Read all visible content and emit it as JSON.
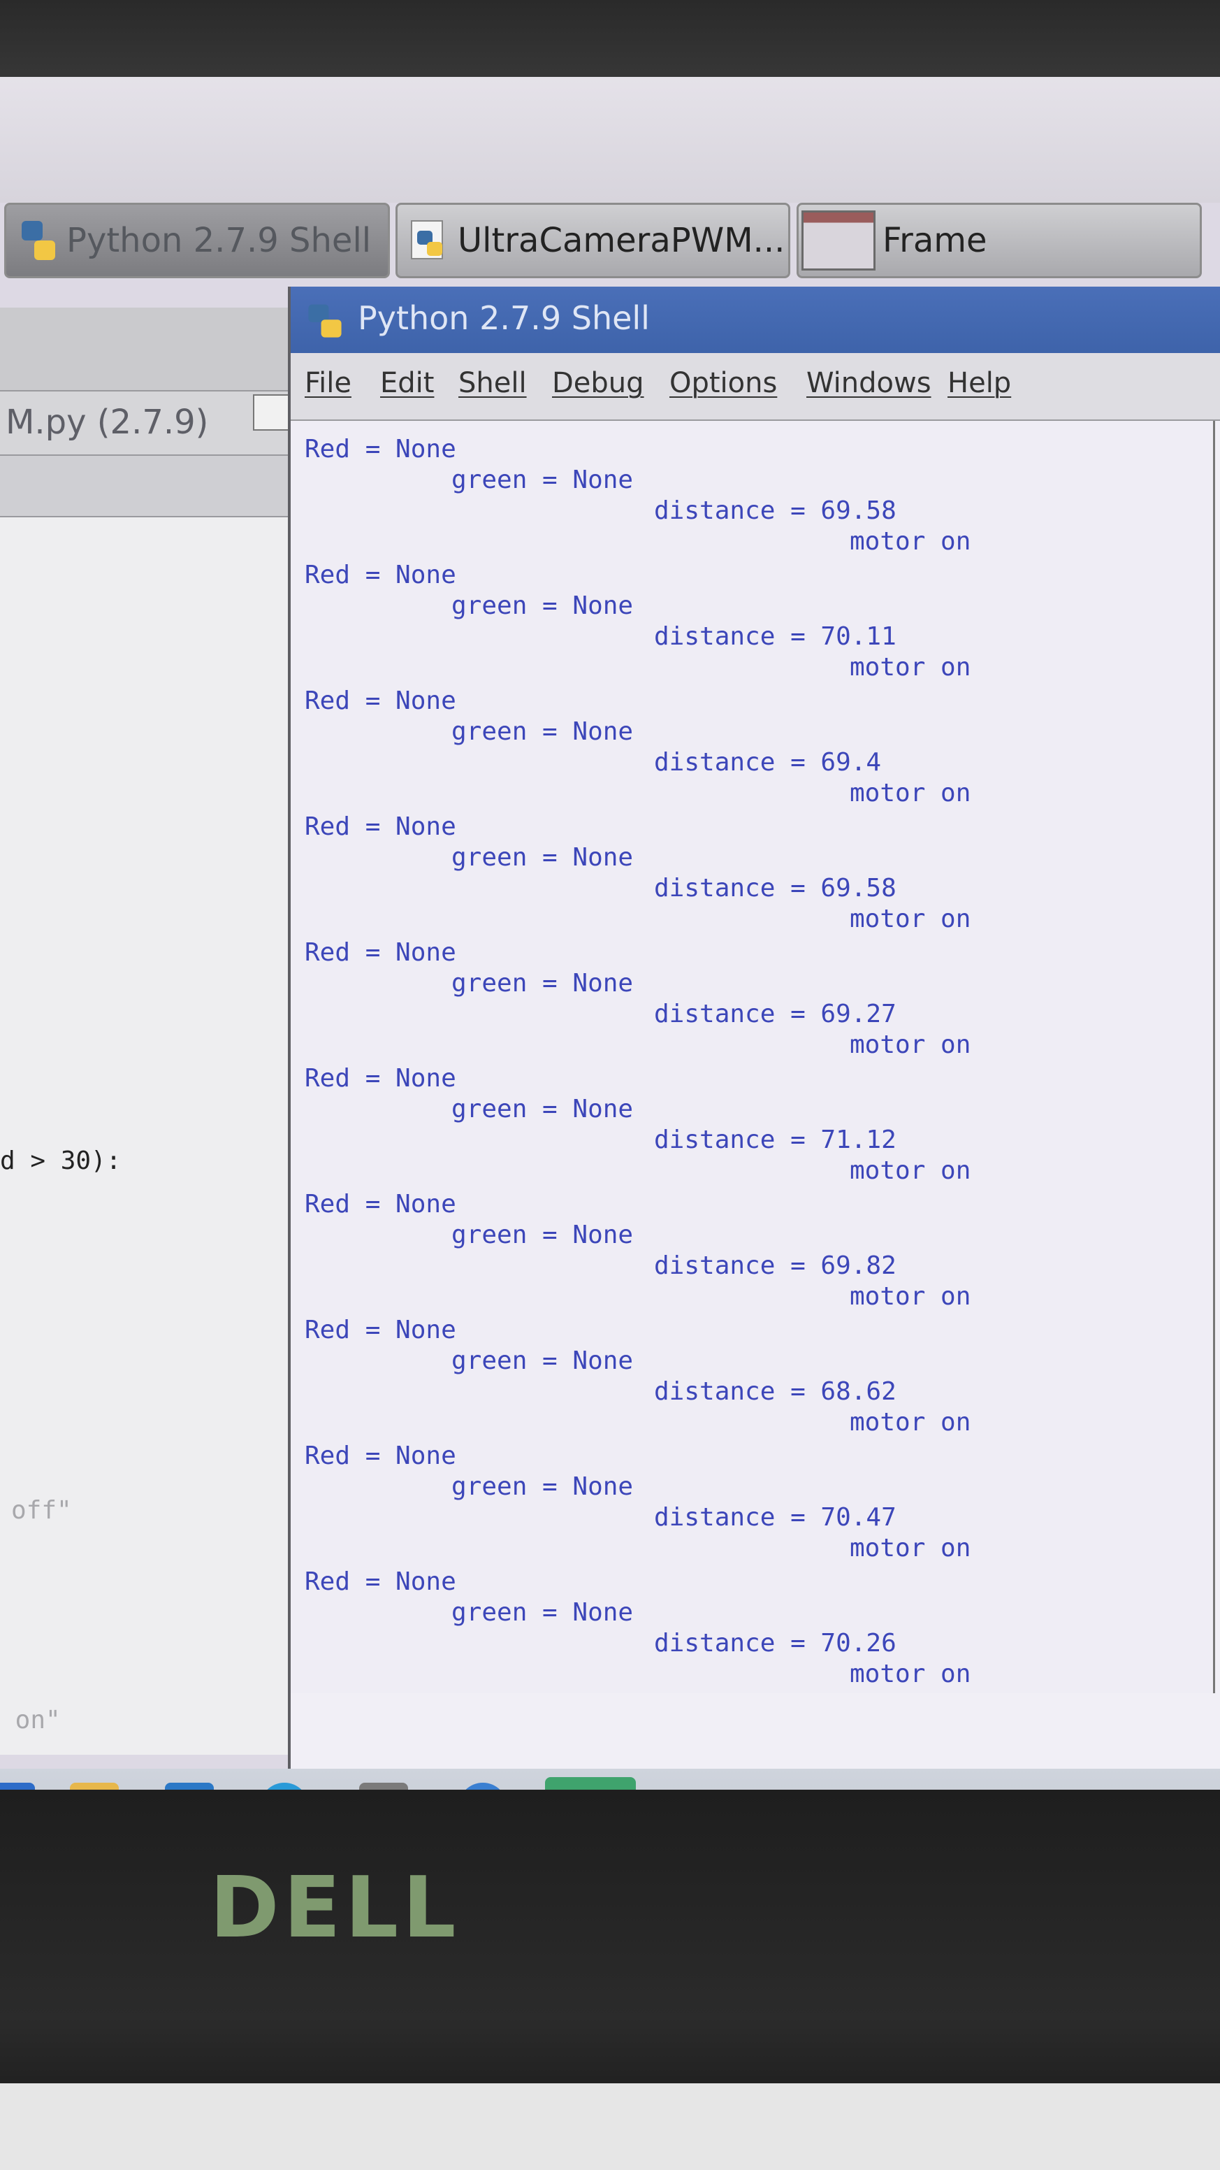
{
  "taskbar_top": {
    "items": [
      {
        "label": "Python 2.7.9 Shell",
        "icon": "python-icon"
      },
      {
        "label": "UltraCameraPWM....",
        "icon": "python-icon"
      },
      {
        "label": "Frame",
        "icon": "frame-window-icon"
      }
    ]
  },
  "editor": {
    "title": "M.py (2.7.9)",
    "visible_code": [
      {
        "text": "d > 30):"
      },
      {
        "text": "off\""
      },
      {
        "text": " on\""
      }
    ]
  },
  "shell": {
    "title": "Python 2.7.9 Shell",
    "menu": [
      "File",
      "Edit",
      "Shell",
      "Debug",
      "Options",
      "Windows",
      "Help"
    ],
    "output_blocks": [
      {
        "red": "Red = None",
        "green": "green = None",
        "distance": "distance = 69.58",
        "motor": "motor on"
      },
      {
        "red": "Red = None",
        "green": "green = None",
        "distance": "distance = 70.11",
        "motor": "motor on"
      },
      {
        "red": "Red = None",
        "green": "green = None",
        "distance": "distance = 69.4",
        "motor": "motor on"
      },
      {
        "red": "Red = None",
        "green": "green = None",
        "distance": "distance = 69.58",
        "motor": "motor on"
      },
      {
        "red": "Red = None",
        "green": "green = None",
        "distance": "distance = 69.27",
        "motor": "motor on"
      },
      {
        "red": "Red = None",
        "green": "green = None",
        "distance": "distance = 71.12",
        "motor": "motor on"
      },
      {
        "red": "Red = None",
        "green": "green = None",
        "distance": "distance = 69.82",
        "motor": "motor on"
      },
      {
        "red": "Red = None",
        "green": "green = None",
        "distance": "distance = 68.62",
        "motor": "motor on"
      },
      {
        "red": "Red = None",
        "green": "green = None",
        "distance": "distance = 70.47",
        "motor": "motor on"
      },
      {
        "red": "Red = None",
        "green": "green = None",
        "distance": "distance = 70.26",
        "motor": "motor on"
      }
    ]
  },
  "taskbar_bottom": {
    "icons": [
      "ie-icon",
      "file-explorer-icon",
      "outlook-icon",
      "skype-icon",
      "tools-icon",
      "internet-explorer-icon",
      "remote-viewer-icon"
    ]
  },
  "logo": "DELL",
  "colors": {
    "output_text": "#3c46b9",
    "title_bar": "#4a6fb8"
  }
}
